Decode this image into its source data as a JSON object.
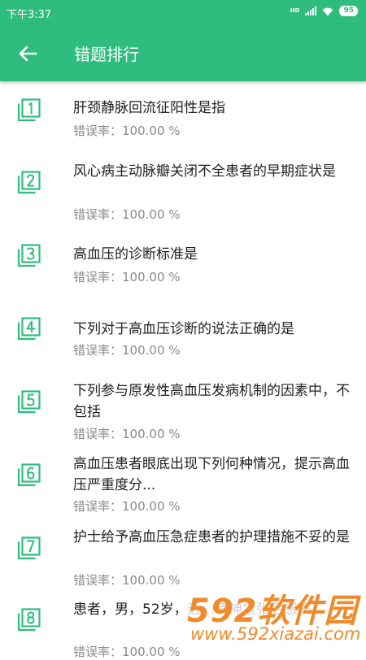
{
  "status_bar": {
    "time": "下午3:37",
    "network_tag": "HD",
    "battery": "95"
  },
  "header": {
    "title": "错题排行",
    "back_icon": "arrow-left-icon"
  },
  "colors": {
    "primary": "#2ebd7e",
    "title_text": "#212121",
    "secondary_text": "#8a8a8a",
    "watermark": "#f08a2a"
  },
  "items": [
    {
      "rank": "1",
      "title": "肝颈静脉回流征阳性是指",
      "rate": "错误率：100.00 %"
    },
    {
      "rank": "2",
      "title": "风心病主动脉瓣关闭不全患者的早期症状是",
      "rate": "错误率：100.00 %"
    },
    {
      "rank": "3",
      "title": "高血压的诊断标准是",
      "rate": "错误率：100.00 %"
    },
    {
      "rank": "4",
      "title": "下列对于高血压诊断的说法正确的是",
      "rate": "错误率：100.00 %"
    },
    {
      "rank": "5",
      "title": "下列参与原发性高血压发病机制的因素中，不包括",
      "rate": "错误率：100.00 %"
    },
    {
      "rank": "6",
      "title": "高血压患者眼底出现下列何种情况，提示高血压严重度分...",
      "rate": "错误率：100.00 %"
    },
    {
      "rank": "7",
      "title": "护士给予高血压急症患者的护理措施不妥的是",
      "rate": "错误率：100.00 %"
    },
    {
      "rank": "8",
      "title": "患者，男，52岁，近...精神紧张后感头...",
      "rate": "错误率：100.00 %"
    }
  ],
  "watermark": {
    "logo": "592软件园",
    "url": "www.592xiazai.com"
  }
}
